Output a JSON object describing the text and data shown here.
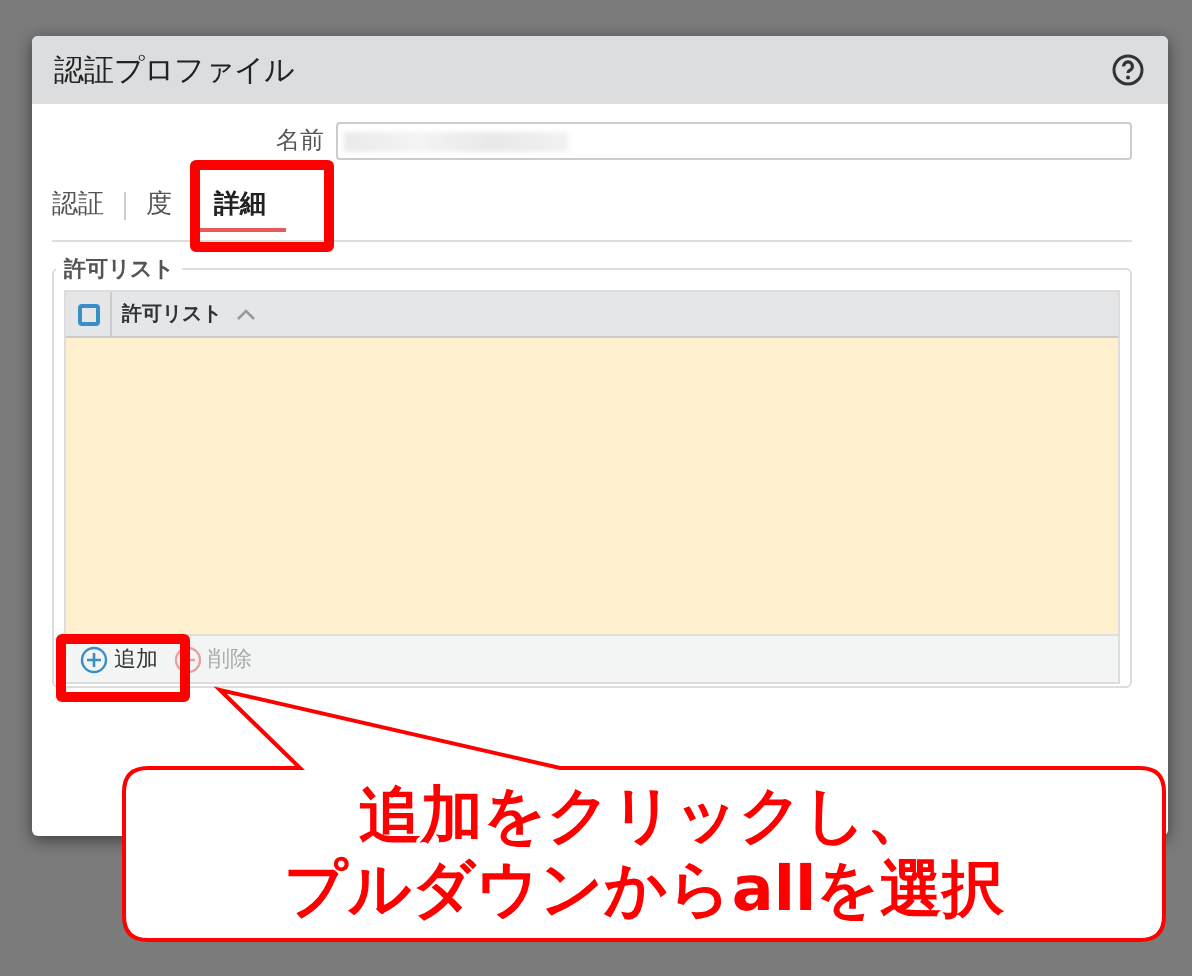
{
  "dialog": {
    "title": "認証プロファイル",
    "name_label": "名前"
  },
  "tabs": [
    {
      "label": "認証",
      "selected": false
    },
    {
      "label": "度",
      "selected": false
    },
    {
      "label": "詳細",
      "selected": true
    }
  ],
  "allow_list": {
    "legend": "許可リスト",
    "column": "許可リスト",
    "header_checked": false
  },
  "actions": [
    {
      "label": "追加",
      "kind": "add",
      "disabled": false
    },
    {
      "label": "削除",
      "kind": "remove",
      "disabled": true
    }
  ],
  "annotation": {
    "lines": [
      "追加をクリックし、",
      "プルダウンからallを選択"
    ]
  }
}
